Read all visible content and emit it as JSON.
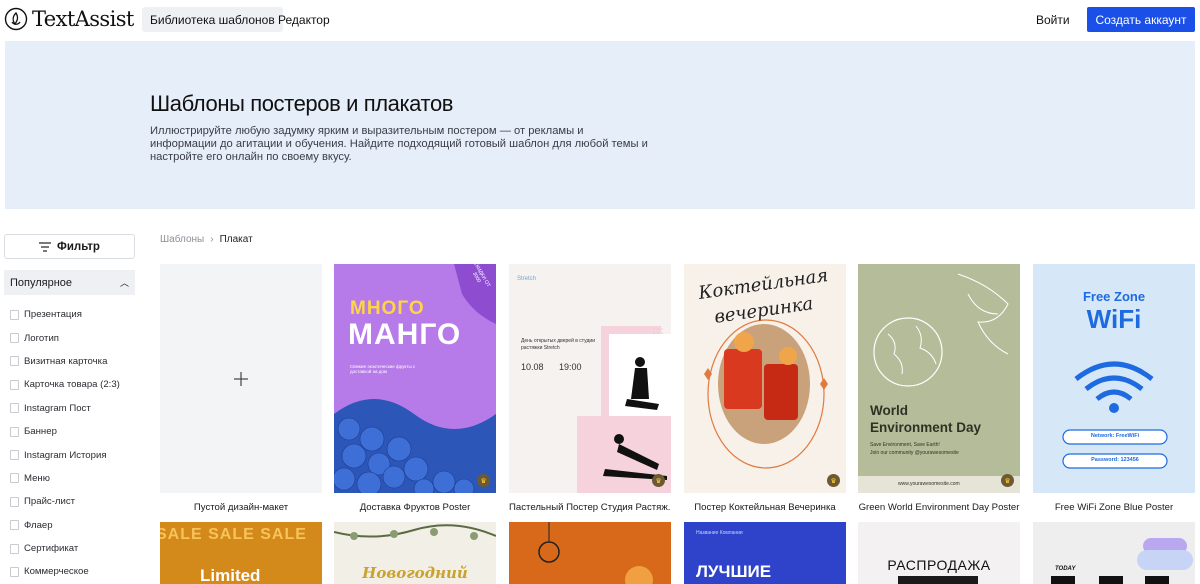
{
  "header": {
    "logo_text": "TextAssist",
    "tabs": [
      {
        "label": "Библиотека шаблонов",
        "active": true
      },
      {
        "label": "Редактор",
        "active": false
      }
    ],
    "login_label": "Войти",
    "signup_label": "Создать аккаунт",
    "accent_color": "#1a4fe8"
  },
  "hero": {
    "title": "Шаблоны постеров и плакатов",
    "description": "Иллюстрируйте любую задумку ярким и выразительным постером — от рекламы и информации до агитации и обучения. Найдите подходящий готовый шаблон для любой темы и настройте его онлайн по своему вкусу.",
    "background": "#e6eef9"
  },
  "sidebar": {
    "filter_label": "Фильтр",
    "section_label": "Популярное",
    "categories": [
      "Презентация",
      "Логотип",
      "Визитная карточка",
      "Карточка товара (2:3)",
      "Instagram Пост",
      "Баннер",
      "Instagram История",
      "Меню",
      "Прайс-лист",
      "Флаер",
      "Сертификат",
      "Коммерческое"
    ]
  },
  "breadcrumb": {
    "root": "Шаблоны",
    "current": "Плакат"
  },
  "templates": [
    {
      "label": "Пустой дизайн-макет",
      "kind": "blank"
    },
    {
      "label": "Доставка Фруктов Poster",
      "kind": "mango",
      "line1": "МНОГО",
      "line2": "МАНГО",
      "sub": "Свежие экзотические фрукты с доставкой на дом",
      "badge": "СКИДКИ ОТ 3000"
    },
    {
      "label": "Пастельный Постер Студия Растяж...",
      "kind": "stretch",
      "brand": "Stretch",
      "line1": "День открытых дверей в студии растяжки Stretch",
      "date": "10.08",
      "time": "19:00"
    },
    {
      "label": "Постер Коктейльная Вечеринка",
      "kind": "cocktail",
      "title1": "Коктейльная",
      "title2": "вечеринка"
    },
    {
      "label": "Green World Environment Day Poster",
      "kind": "world",
      "title1": "World",
      "title2": "Environment Day",
      "sub1": "Save Environment, Save Earth!",
      "sub2": "Join our community @yourawesomesite",
      "url": "www.yourawesomesite.com"
    },
    {
      "label": "Free WiFi Zone Blue Poster",
      "kind": "wifi",
      "title1": "Free Zone",
      "title2": "WiFi",
      "network": "Network: FreeWiFi",
      "password": "Password: 123456"
    }
  ],
  "row2": [
    {
      "kind": "sale",
      "text": "SALE SALE SALE",
      "sub": "Limited"
    },
    {
      "kind": "newyear",
      "text": "Новогодний"
    },
    {
      "kind": "halloween",
      "text": ""
    },
    {
      "kind": "best",
      "top": "Название Компании",
      "text": "ЛУЧШИЕ"
    },
    {
      "kind": "rasprodazha",
      "text": "РАСПРОДАЖА"
    },
    {
      "kind": "today",
      "text": "TODAY"
    }
  ]
}
